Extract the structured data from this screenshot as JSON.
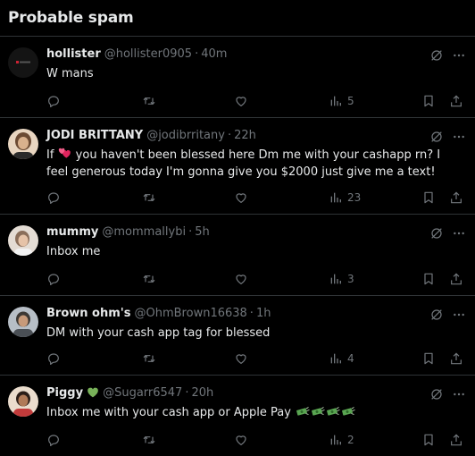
{
  "header": {
    "title": "Probable spam"
  },
  "tweets": [
    {
      "name": "hollister",
      "handle": "@hollister0905",
      "dot": "·",
      "time": "40m",
      "text": "W mans",
      "views": "5",
      "avatar_colors": [
        "#1a1a1a",
        "#cc2233"
      ]
    },
    {
      "name": "JODI BRITTANY",
      "handle": "@jodibrritany",
      "dot": "·",
      "time": "22h",
      "text_parts": [
        "If ",
        " you haven't been blessed here Dm me with your cashapp rn? I feel generous  today I'm gonna give you $2000 just give me a text!"
      ],
      "views": "23",
      "avatar_colors": [
        "#c8a88a",
        "#6b4a33"
      ]
    },
    {
      "name": "mummy",
      "handle": "@mommallybi",
      "dot": "·",
      "time": "5h",
      "text": "Inbox me",
      "views": "3",
      "avatar_colors": [
        "#d9c7b8",
        "#7a6a60"
      ]
    },
    {
      "name": "Brown ohm's",
      "handle": "@OhmBrown16638",
      "dot": "·",
      "time": "1h",
      "text": "DM with your cash app tag for blessed",
      "views": "4",
      "avatar_colors": [
        "#a8b0b8",
        "#4a4f55"
      ]
    },
    {
      "name": "Piggy",
      "handle": "@Sugarr6547",
      "dot": "·",
      "time": "20h",
      "text": "Inbox me with your cash app or Apple Pay",
      "views": "2",
      "avatar_colors": [
        "#c23b3b",
        "#e8d8c8"
      ]
    }
  ],
  "colors": {
    "background": "#000000",
    "text": "#e7e9ea",
    "muted": "#71767b",
    "divider": "#2f3336",
    "heart_emoji": "#e0245e",
    "green_heart": "#78b159",
    "money_green": "#5aa552"
  },
  "icons": {
    "grok": "grok-icon",
    "more": "more-icon",
    "reply": "reply-icon",
    "retweet": "retweet-icon",
    "like": "like-icon",
    "views": "views-icon",
    "bookmark": "bookmark-icon",
    "share": "share-icon"
  }
}
